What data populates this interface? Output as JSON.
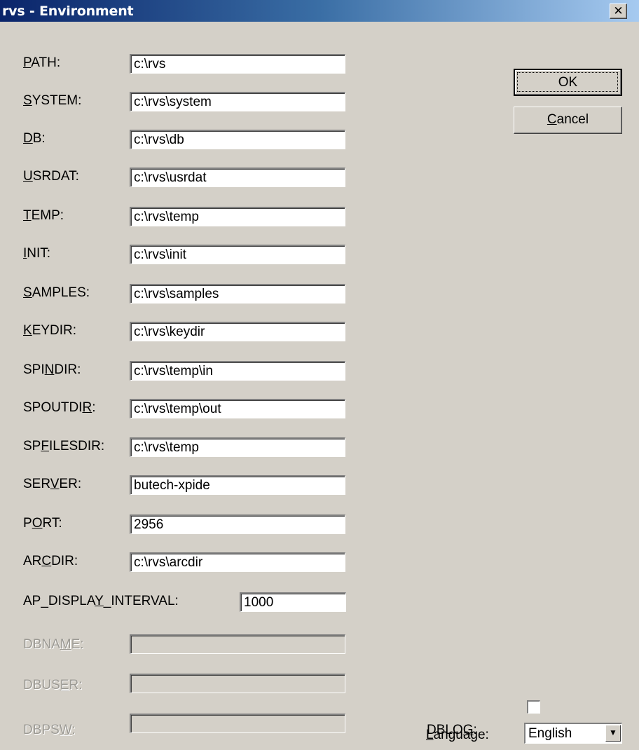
{
  "window": {
    "title": "rvs - Environment",
    "close_glyph": "✕"
  },
  "fields": [
    {
      "pre": "",
      "acc": "P",
      "post": "ATH:",
      "value": "c:\\rvs"
    },
    {
      "pre": "",
      "acc": "S",
      "post": "YSTEM:",
      "value": "c:\\rvs\\system"
    },
    {
      "pre": "",
      "acc": "D",
      "post": "B:",
      "value": "c:\\rvs\\db"
    },
    {
      "pre": "",
      "acc": "U",
      "post": "SRDAT:",
      "value": "c:\\rvs\\usrdat"
    },
    {
      "pre": "",
      "acc": "T",
      "post": "EMP:",
      "value": "c:\\rvs\\temp"
    },
    {
      "pre": "",
      "acc": "I",
      "post": "NIT:",
      "value": "c:\\rvs\\init"
    },
    {
      "pre": "",
      "acc": "S",
      "post": "AMPLES:",
      "value": "c:\\rvs\\samples"
    },
    {
      "pre": "",
      "acc": "K",
      "post": "EYDIR:",
      "value": "c:\\rvs\\keydir"
    },
    {
      "pre": "SPI",
      "acc": "N",
      "post": "DIR:",
      "value": "c:\\rvs\\temp\\in"
    },
    {
      "pre": "SPOUTDI",
      "acc": "R",
      "post": ":",
      "value": "c:\\rvs\\temp\\out"
    },
    {
      "pre": "SP",
      "acc": "F",
      "post": "ILESDIR:",
      "value": "c:\\rvs\\temp"
    },
    {
      "pre": "SER",
      "acc": "V",
      "post": "ER:",
      "value": "butech-xpide"
    },
    {
      "pre": "P",
      "acc": "O",
      "post": "RT:",
      "value": "2956"
    },
    {
      "pre": "AR",
      "acc": "C",
      "post": "DIR:",
      "value": "c:\\rvs\\arcdir"
    }
  ],
  "interval": {
    "pre": "AP_DISPLA",
    "acc": "Y",
    "post": "_INTERVAL:",
    "value": "1000"
  },
  "disabled_fields": [
    {
      "pre": "DBNA",
      "acc": "M",
      "post": "E:",
      "value": ""
    },
    {
      "pre": "DBUS",
      "acc": "E",
      "post": "R:",
      "value": ""
    },
    {
      "pre": "DBPS",
      "acc": "W",
      "post": ":",
      "value": ""
    }
  ],
  "buttons": {
    "ok": {
      "label": "OK"
    },
    "cancel": {
      "acc": "C",
      "post": "ancel"
    }
  },
  "dblog": {
    "pre": "DBLO",
    "acc": "G",
    "post": ":",
    "checked": false
  },
  "language": {
    "acc": "L",
    "post": "anguage:",
    "value": "English",
    "arrow_glyph": "▼"
  }
}
